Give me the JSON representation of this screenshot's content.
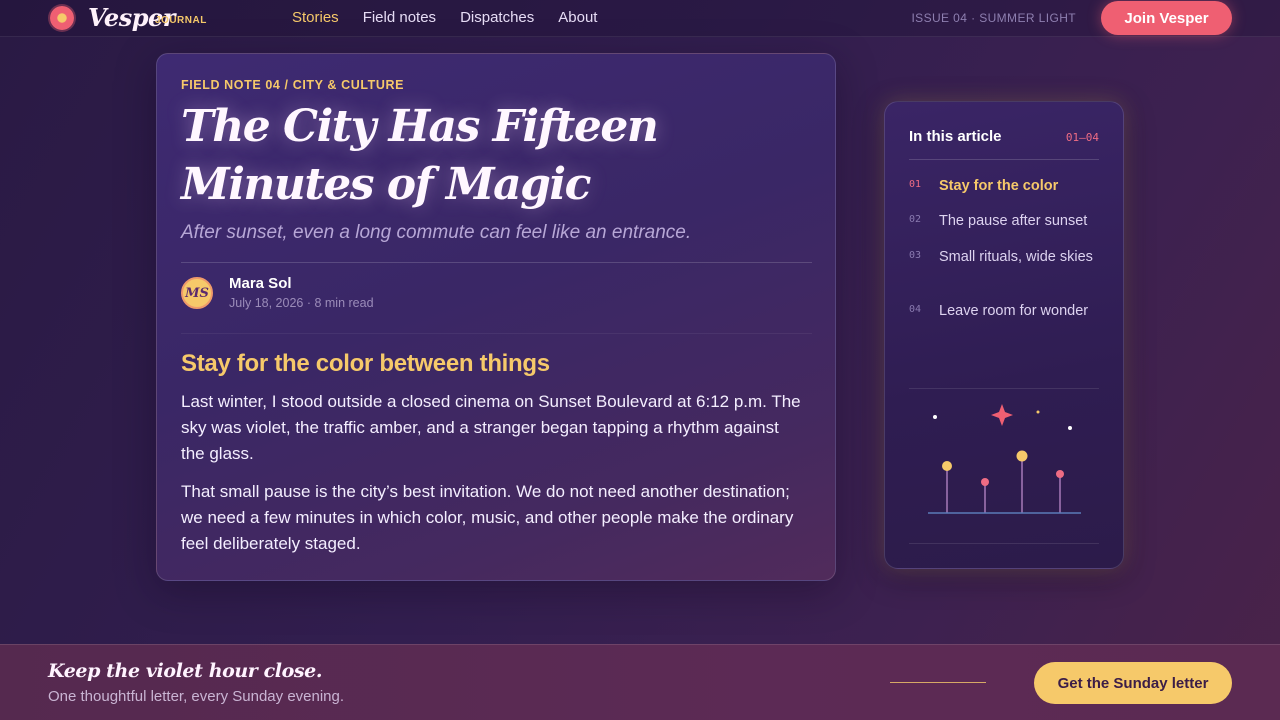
{
  "header": {
    "brand": "Vesper",
    "brand_sub": "JOURNAL",
    "nav": [
      {
        "label": "Stories",
        "active": true
      },
      {
        "label": "Field notes",
        "active": false
      },
      {
        "label": "Dispatches",
        "active": false
      },
      {
        "label": "About",
        "active": false
      }
    ],
    "issue": "ISSUE 04 · SUMMER LIGHT",
    "cta": "Join Vesper"
  },
  "article": {
    "eyebrow": "FIELD NOTE 04 / CITY & CULTURE",
    "title": "The City Has Fifteen Minutes of Magic",
    "dek": "After sunset, even a long commute can feel like an entrance.",
    "author": {
      "initials": "MS",
      "name": "Mara Sol",
      "meta": "July 18, 2026 · 8 min read"
    },
    "section_heading": "Stay for the color between things",
    "paragraphs": [
      "Last winter, I stood outside a closed cinema on Sunset Boulevard at 6:12 p.m. The sky was violet, the traffic amber, and a stranger began tapping a rhythm against the glass.",
      "That small pause is the city’s best invitation. We do not need another destination; we need a few minutes in which color, music, and other people make the ordinary feel deliberately staged."
    ]
  },
  "toc": {
    "title": "In this article",
    "range": "01–04",
    "items": [
      {
        "num": "01",
        "label": "Stay for the color",
        "active": true
      },
      {
        "num": "02",
        "label": "The pause after sunset",
        "active": false
      },
      {
        "num": "03",
        "label": "Small rituals, wide skies",
        "active": false
      },
      {
        "num": "04",
        "label": "Leave room for wonder",
        "active": false
      }
    ]
  },
  "footer": {
    "title": "Keep the violet hour close.",
    "subtitle": "One thoughtful letter, every Sunday evening.",
    "cta": "Get the Sunday letter"
  },
  "colors": {
    "accent_gold": "#f6c96a",
    "accent_coral": "#ef5f72",
    "violet": "#3e2a72"
  }
}
